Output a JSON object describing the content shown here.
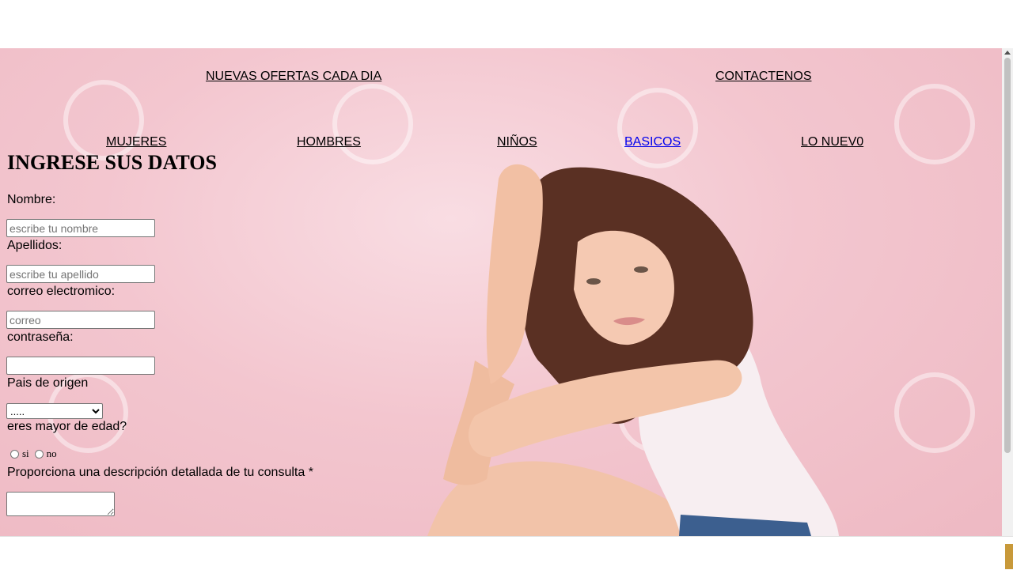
{
  "nav_top": {
    "offers": "NUEVAS OFERTAS CADA DIA",
    "contact": "CONTACTENOS"
  },
  "nav_categories": {
    "mujeres": "MUJERES",
    "hombres": "HOMBRES",
    "ninos": "NIÑOS",
    "basicos": "BASICOS",
    "lo_nuevo": "LO NUEV0"
  },
  "form": {
    "title": "INGRESE SUS DATOS",
    "nombre_label": "Nombre:",
    "nombre_placeholder": "escribe tu nombre",
    "apellidos_label": "Apellidos:",
    "apellidos_placeholder": "escribe tu apellido",
    "correo_label": "correo electromico:",
    "correo_placeholder": "correo",
    "password_label": "contraseña:",
    "pais_label": "Pais de origen",
    "pais_selected": ".....",
    "edad_label": "eres mayor de edad?",
    "radio_si": "si",
    "radio_no": "no",
    "consulta_label": "Proporciona una descripción detallada de tu consulta *"
  },
  "colors": {
    "background_pink": "#f3c6cf",
    "visited_link": "#0000ee",
    "accent_bottom": "#c8993a"
  }
}
